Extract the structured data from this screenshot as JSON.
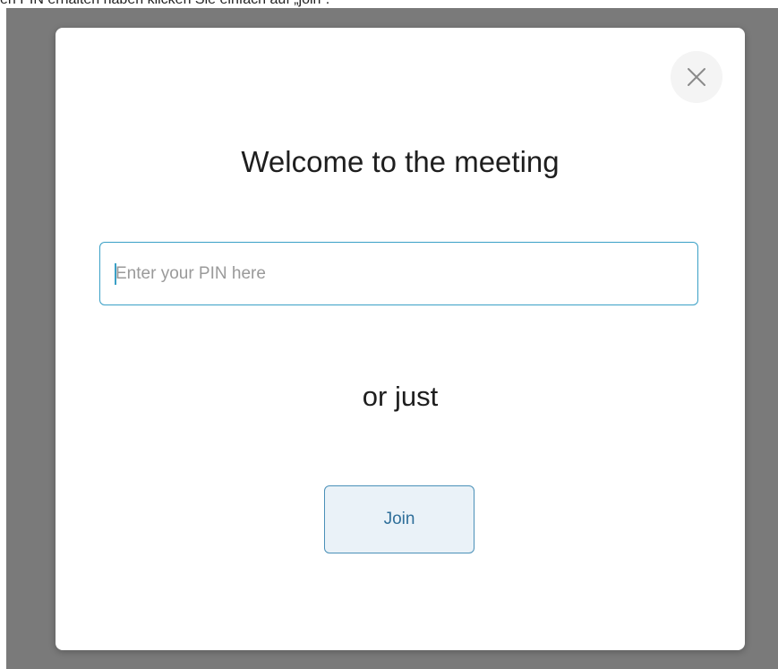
{
  "background": {
    "partial_text": "en PIN erhalten haben klicken Sie einfach auf „join“."
  },
  "modal": {
    "close_icon": "close-icon",
    "title": "Welcome to the meeting",
    "pin_input": {
      "value": "",
      "placeholder": "Enter your PIN here"
    },
    "or_text": "or just",
    "join_label": "Join"
  },
  "colors": {
    "overlay": "#7a7a7a",
    "input_border": "#3aa0c6",
    "join_border": "#4a90b8",
    "join_background": "#eaf2f8",
    "join_text": "#2f6f9a"
  }
}
